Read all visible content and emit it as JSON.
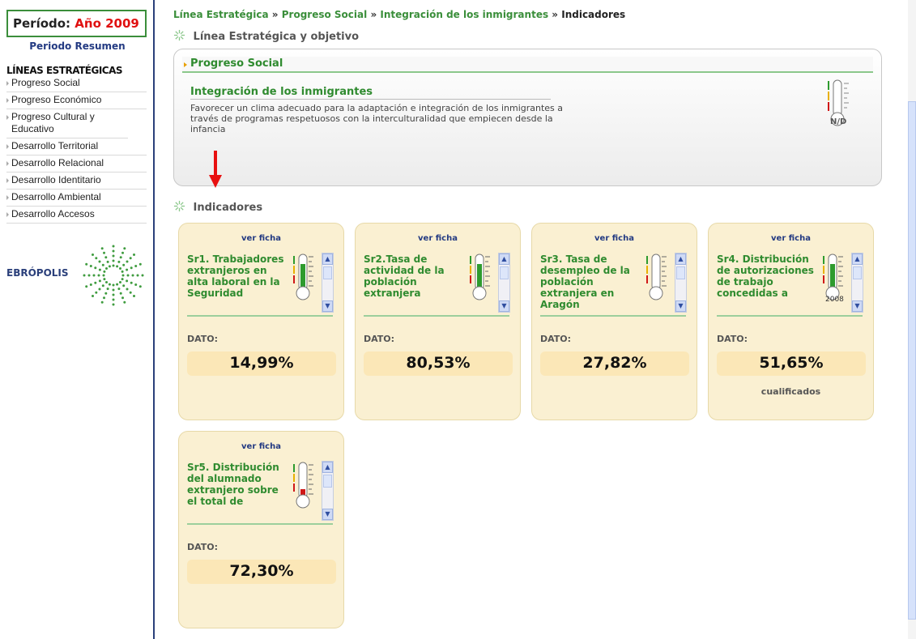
{
  "sidebar": {
    "periodo_label": "Período:",
    "periodo_year": "Año 2009",
    "resumen_link": "Periodo Resumen",
    "lineas_title": "LÍNEAS ESTRATÉGICAS",
    "items": [
      {
        "label": "Progreso Social"
      },
      {
        "label": "Progreso Económico"
      },
      {
        "label": "Progreso Cultural y Educativo"
      },
      {
        "label": "Desarrollo Territorial"
      },
      {
        "label": "Desarrollo Relacional"
      },
      {
        "label": "Desarrollo Identitario"
      },
      {
        "label": "Desarrollo Ambiental"
      },
      {
        "label": "Desarrollo Accesos"
      }
    ],
    "logo_text": "EBRÓPOLIS"
  },
  "breadcrumb": {
    "items": [
      "Línea Estratégica",
      "Progreso Social",
      "Integración de los inmigrantes"
    ],
    "separator": "»",
    "current": "Indicadores"
  },
  "section_linea": {
    "title": "Línea Estratégica y objetivo"
  },
  "linea_panel": {
    "header": "Progreso Social",
    "objective_title": "Integración de los inmigrantes",
    "description": "Favorecer un clima adecuado para la adaptación e integración de los inmigrantes a través de programas respetuosos con la interculturalidad que empiecen desde la infancia",
    "thermometer_label": "N/D"
  },
  "section_indicadores": {
    "title": "Indicadores"
  },
  "indicators": [
    {
      "ver": "ver ficha",
      "name": "Sr1. Trabajadores extranjeros en alta laboral en la Seguridad",
      "dato_label": "DATO:",
      "value": "14,99%",
      "extra": "",
      "fill_level": 0.82,
      "fill_color": "#2e9b2e"
    },
    {
      "ver": "ver ficha",
      "name": "Sr2.Tasa de actividad de la población extranjera",
      "dato_label": "DATO:",
      "value": "80,53%",
      "extra": "",
      "fill_level": 0.82,
      "fill_color": "#2e9b2e"
    },
    {
      "ver": "ver ficha",
      "name": "Sr3. Tasa de desempleo de la población extranjera en Aragón",
      "dato_label": "DATO:",
      "value": "27,82%",
      "extra": "",
      "fill_level": 0.05,
      "fill_color": "#d01818"
    },
    {
      "ver": "ver ficha",
      "name": "Sr4. Distribución de autorizaciones de trabajo concedidas a",
      "dato_label": "DATO:",
      "value": "51,65%",
      "extra": "cualificados",
      "thermo_year": "2008",
      "fill_level": 0.82,
      "fill_color": "#2e9b2e"
    },
    {
      "ver": "ver ficha",
      "name": "Sr5. Distribución del alumnado extranjero sobre el total de",
      "dato_label": "DATO:",
      "value": "72,30%",
      "extra": "",
      "fill_level": 0.25,
      "fill_color": "#d01818"
    }
  ],
  "colors": {
    "accent_green": "#2f8b2f",
    "link_blue": "#233a82",
    "card_bg": "#faf0d2",
    "value_bg": "#fbe7b7",
    "periodo_red": "#e01010"
  }
}
